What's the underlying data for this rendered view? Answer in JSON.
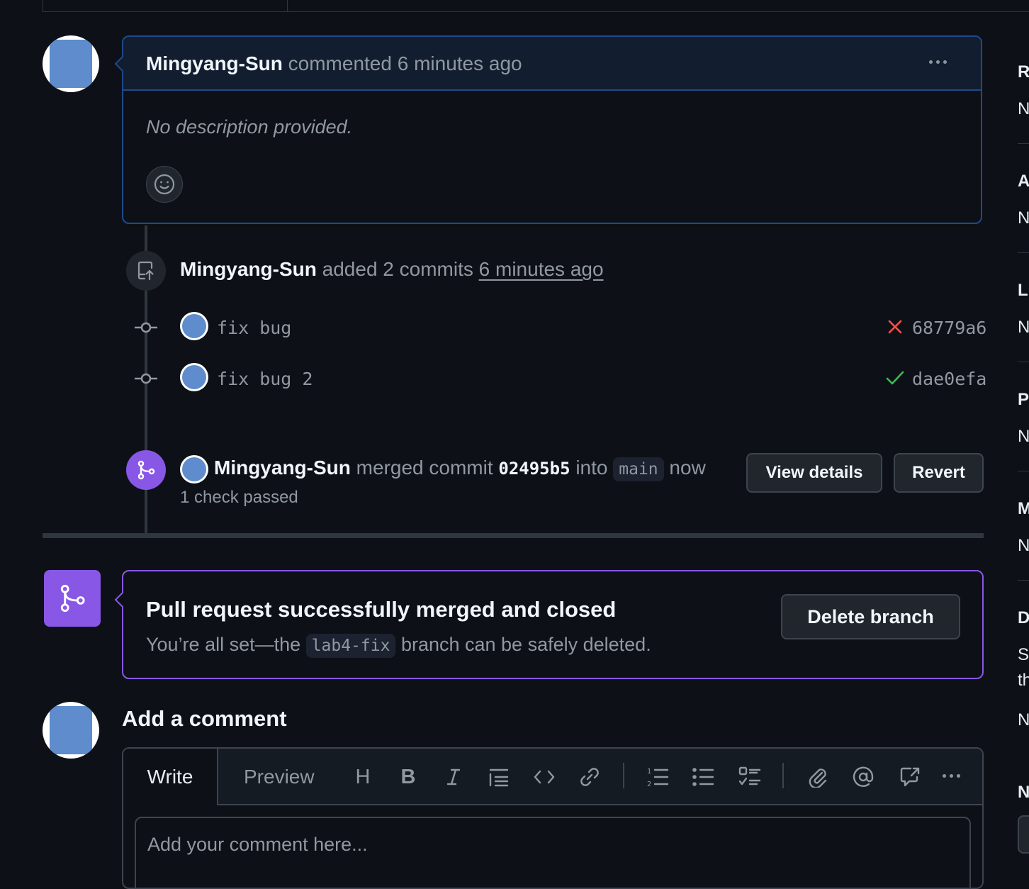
{
  "comment": {
    "author": "Mingyang-Sun",
    "action": "commented",
    "time": "6 minutes ago",
    "body": "No description provided."
  },
  "commits_event": {
    "author": "Mingyang-Sun",
    "action": "added 2 commits",
    "time": "6 minutes ago",
    "commits": [
      {
        "message": "fix bug",
        "status": "failure",
        "sha": "68779a6"
      },
      {
        "message": "fix bug 2",
        "status": "success",
        "sha": "dae0efa"
      }
    ]
  },
  "merge_event": {
    "author": "Mingyang-Sun",
    "action": "merged commit",
    "commit": "02495b5",
    "into": "into",
    "branch": "main",
    "time": "now",
    "checks": "1 check passed",
    "view_details": "View details",
    "revert": "Revert"
  },
  "merged_box": {
    "title": "Pull request successfully merged and closed",
    "desc_prefix": "You’re all set—the",
    "branch": "lab4-fix",
    "desc_suffix": "branch can be safely deleted.",
    "delete_button": "Delete branch"
  },
  "add_comment": {
    "title": "Add a comment",
    "tab_write": "Write",
    "tab_preview": "Preview",
    "heading_tool": "H",
    "bold_tool": "B",
    "placeholder": "Add your comment here..."
  },
  "sidebar_letters": [
    "R",
    "N",
    "A",
    "N",
    "L",
    "N",
    "P",
    "N",
    "M",
    "N",
    "D",
    "S",
    "th",
    "N",
    "N"
  ],
  "colors": {
    "background": "#0d1117",
    "accent_blue": "#1f4a8a",
    "merged_purple": "#8957e5",
    "fail_red": "#f85149",
    "success_green": "#3fb950"
  }
}
